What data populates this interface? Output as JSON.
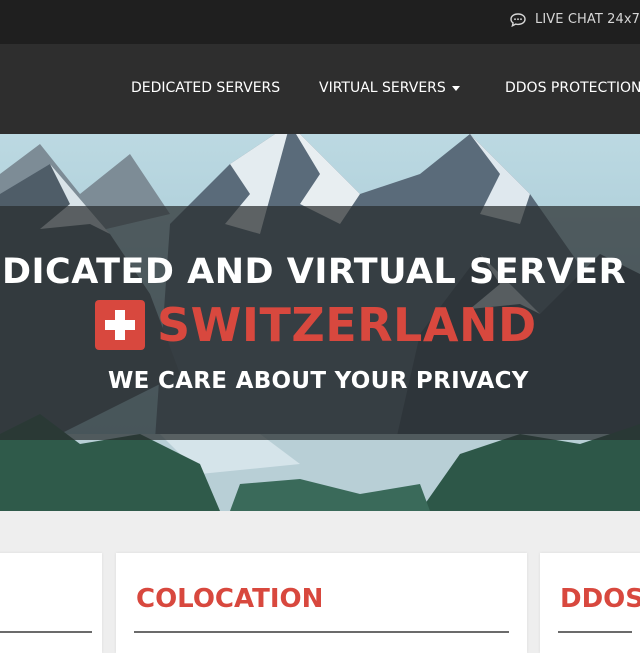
{
  "topbar": {
    "live_chat_label": "LIVE CHAT 24x7",
    "live_chat_icon": "chat-bubble-icon"
  },
  "nav": {
    "items": [
      {
        "label": "DEDICATED SERVERS"
      },
      {
        "label": "VIRTUAL SERVERS",
        "has_dropdown": true
      },
      {
        "label": "DDOS PROTECTION"
      }
    ]
  },
  "hero": {
    "title": "DEDICATED AND VIRTUAL SERVER HOSTING",
    "country": "SWITZERLAND",
    "flag_icon": "swiss-flag-icon",
    "tagline": "WE CARE ABOUT YOUR PRIVACY"
  },
  "cards": [
    {
      "title": ""
    },
    {
      "title": "COLOCATION"
    },
    {
      "title": "DDOS"
    }
  ],
  "colors": {
    "accent": "#d8483e",
    "topbar": "#1f1f1f",
    "navbar": "#2e2e2e",
    "page_background": "#eeeeee"
  }
}
